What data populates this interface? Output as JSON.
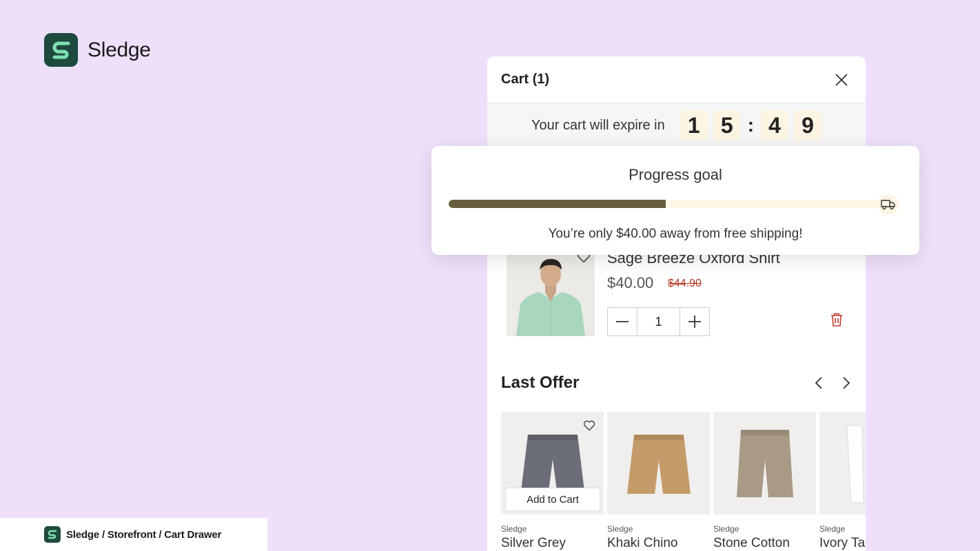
{
  "brand": {
    "name": "Sledge",
    "color": "#1e4a3f"
  },
  "breadcrumb": {
    "text": "Sledge / Storefront / Cart Drawer"
  },
  "cart": {
    "title": "Cart (1)",
    "timer_label": "Your cart will expire in",
    "digits": [
      "1",
      "5",
      "4",
      "9"
    ],
    "separator": ":"
  },
  "goal": {
    "title": "Progress goal",
    "progress": 0.5,
    "message": "You’re only $40.00 away from free shipping!",
    "icon": "truck-icon"
  },
  "product": {
    "name": "Sage Breeze Oxford Shirt",
    "price": "$40.00",
    "old_price": "$44.90",
    "quantity": "1"
  },
  "offer": {
    "title": "Last Offer",
    "add_label": "Add to Cart",
    "items": [
      {
        "brand": "Sledge",
        "name": "Silver Grey",
        "color": "#6b6d78"
      },
      {
        "brand": "Sledge",
        "name": "Khaki Chino",
        "color": "#c49c6a"
      },
      {
        "brand": "Sledge",
        "name": "Stone Cotton",
        "color": "#a89a85"
      },
      {
        "brand": "Sledge",
        "name": "Ivory Ta",
        "color": "#f2f2ee"
      }
    ]
  },
  "colors": {
    "background": "#eee0fa",
    "accent": "#685d3f",
    "danger": "#b5341f"
  }
}
